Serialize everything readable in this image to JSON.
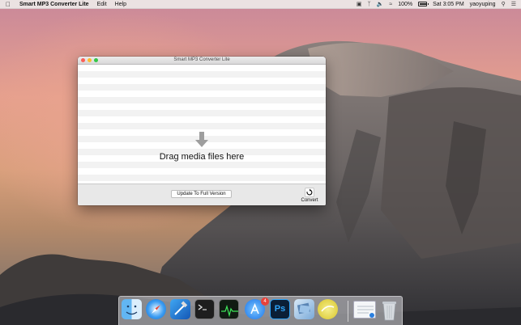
{
  "menubar": {
    "app_name": "Smart MP3 Converter Lite",
    "menus": [
      "Edit",
      "Help"
    ],
    "battery": "100%",
    "clock": "Sat 3:05 PM",
    "user": "yaoyuping"
  },
  "window": {
    "title": "Smart MP3 Converter Lite",
    "drop_text": "Drag media files here",
    "update_button": "Update To Full Version",
    "convert_label": "Convert"
  },
  "dock": {
    "items": [
      "finder-icon",
      "safari-icon",
      "xcode-icon",
      "terminal-icon",
      "activity-monitor-icon",
      "app-store-icon",
      "photoshop-icon",
      "preview-icon",
      "smart-mp3-converter-icon",
      "mail-doc-icon",
      "trash-icon"
    ],
    "app_store_badge": "4",
    "photoshop_label": "Ps"
  },
  "colors": {
    "close": "#fc5f57",
    "minimize": "#fdbc2e",
    "maximize": "#33c748",
    "badge": "#e8423b"
  }
}
